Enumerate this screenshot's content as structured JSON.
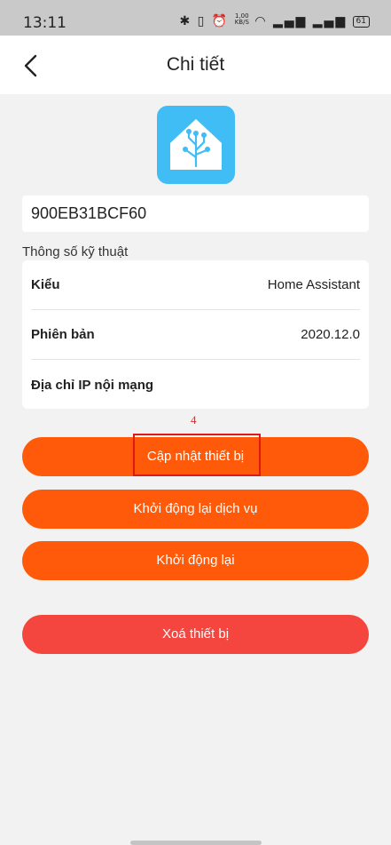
{
  "status_bar": {
    "time": "13:11",
    "speed": "1,00",
    "speed_unit": "KB/S",
    "battery": "61"
  },
  "header": {
    "title": "Chi tiết"
  },
  "device": {
    "id": "900EB31BCF60"
  },
  "specs": {
    "section_title": "Thông số kỹ thuật",
    "rows": [
      {
        "label": "Kiểu",
        "value": "Home Assistant"
      },
      {
        "label": "Phiên bản",
        "value": "2020.12.0"
      },
      {
        "label": "Địa chỉ IP nội mạng",
        "value": ""
      }
    ]
  },
  "annotation": {
    "number": "4"
  },
  "actions": {
    "update": "Cập nhật thiết bị",
    "restart_service": "Khởi động lại dịch vụ",
    "restart": "Khởi động lại",
    "delete": "Xoá thiết bị"
  },
  "colors": {
    "accent": "#ff5a0a",
    "danger": "#f4463f",
    "icon_bg": "#41bdf5"
  }
}
